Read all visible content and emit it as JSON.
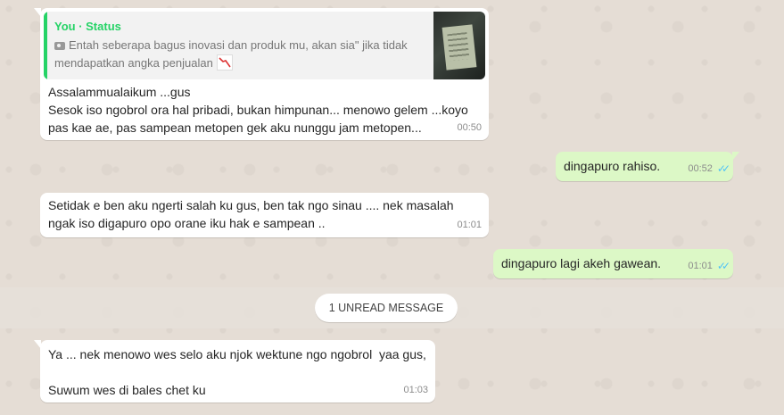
{
  "messages": [
    {
      "reply": {
        "author": "You · Status",
        "text": "Entah seberapa bagus inovasi dan produk mu, akan sia\" jika tidak mendapatkan angka penjualan"
      },
      "text": "Assalammualaikum ...gus\nSesok iso ngobrol ora hal pribadi, bukan himpunan... menowo gelem ...koyo pas kae ae, pas sampean metopen gek aku nunggu jam metopen...",
      "time": "00:50",
      "direction": "incoming"
    },
    {
      "text": "dingapuro rahiso.",
      "time": "00:52",
      "direction": "outgoing"
    },
    {
      "text": "Setidak e ben aku ngerti salah ku gus, ben tak ngo sinau .... nek masalah ngak iso digapuro opo orane iku hak e sampean ..",
      "time": "01:01",
      "direction": "incoming"
    },
    {
      "text": "dingapuro lagi akeh gawean.",
      "time": "01:01",
      "direction": "outgoing"
    },
    {
      "text": "Ya ... nek menowo wes selo aku njok wektune ngo ngobrol  yaa gus,\n\nSuwum wes di bales chet ku",
      "time": "01:03",
      "direction": "incoming"
    }
  ],
  "unread_label": "1 UNREAD MESSAGE",
  "colors": {
    "incoming": "#ffffff",
    "outgoing": "#dcf8c6",
    "accent": "#25d366",
    "read_ticks": "#4fc3f7"
  },
  "icons": {
    "quote": "camera-icon",
    "emoji": "chart-decreasing-icon",
    "read": "double-check-icon"
  }
}
